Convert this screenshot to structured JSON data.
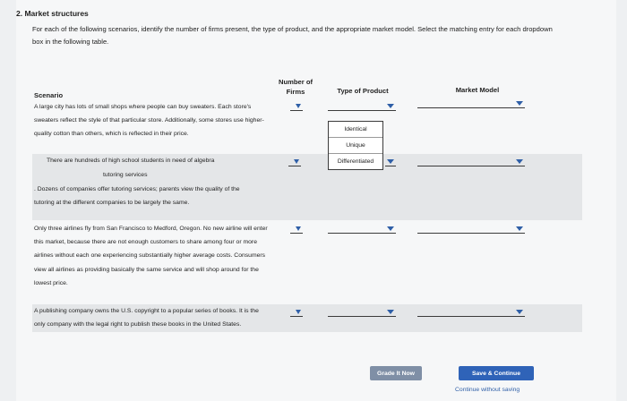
{
  "question": {
    "title": "2. Market structures",
    "instructions": "For each of the following scenarios, identify the number of firms present, the type of product, and the appropriate market model. Select the matching entry for each dropdown box in the following table."
  },
  "table": {
    "headers": {
      "scenario": "Scenario",
      "number_of_firms": "Number of Firms",
      "type_of_product": "Type of Product",
      "market_model": "Market Model"
    },
    "rows": [
      {
        "scenario": "A large city has lots of small shops where people can buy sweaters. Each store's sweaters reflect the style of that particular store. Additionally, some stores use higher-quality cotton than others, which is reflected in their price."
      },
      {
        "scenario_part1": "There are hundreds of high school students in need of algebra",
        "scenario_part2": "tutoring services",
        "scenario_part3": ". Dozens of companies offer tutoring services; parents view the quality of the tutoring at the different companies to be largely the same."
      },
      {
        "scenario": "Only three airlines fly from San Francisco to Medford, Oregon. No new airline will enter this market, because there are not enough customers to share among four or more airlines without each one experiencing substantially higher average costs. Consumers view all airlines as providing basically the same service and will shop around for the lowest price."
      },
      {
        "scenario": "A publishing company owns the U.S. copyright to a popular series of books. It is the only company with the legal right to publish these books in the United States."
      }
    ]
  },
  "product_type_menu": {
    "options": [
      "Identical",
      "Unique",
      "Differentiated"
    ]
  },
  "buttons": {
    "grade": "Grade It Now",
    "save": "Save & Continue",
    "continue_without_saving": "Continue without saving"
  },
  "colors": {
    "accent": "#2f63b8",
    "grade_button": "#7f8fa6",
    "shaded_row": "#e4e6e8"
  }
}
